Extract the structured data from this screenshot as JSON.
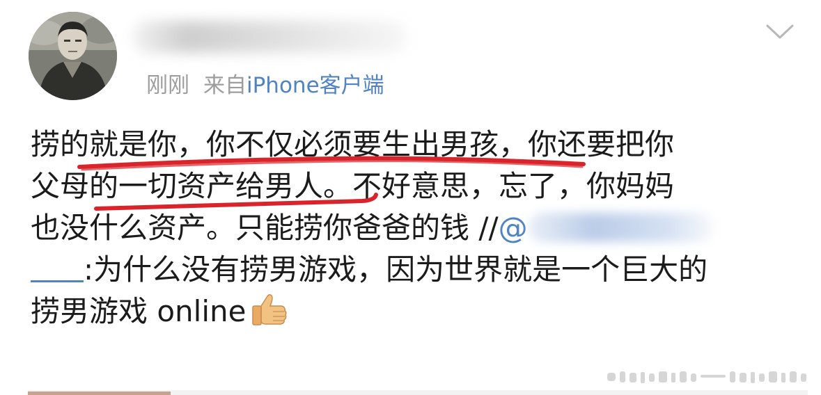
{
  "post": {
    "author": {
      "avatar_icon": "avatar-photo",
      "username_visible": false
    },
    "meta": {
      "time": "刚刚",
      "source_prefix": "来自",
      "source": "iPhone客户端"
    },
    "menu_icon": "chevron-down-icon",
    "body": {
      "line1": "捞的就是你，你不仅必须要生出男孩，你还要把你",
      "line2": "父母的一切资产给男人。不好意思，忘了，你妈妈",
      "line3_text": "也没什么资产。只能捞你爸爸的钱 //",
      "mention_at": "@",
      "line4_text": ":为什么没有捞男游戏，因为世界就是一个巨大的",
      "line5_text": "捞男游戏 online",
      "emoji": "thumbs-up-icon"
    },
    "colors": {
      "text": "#1b1b1b",
      "meta": "#9d9d9d",
      "link": "#4f83c2",
      "highlight_underline": "#d8242a"
    }
  }
}
